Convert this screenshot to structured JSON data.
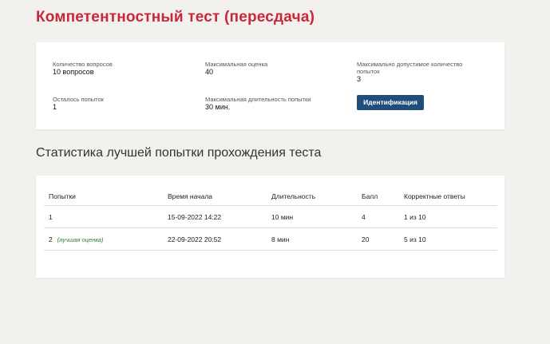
{
  "header": {
    "title": "Компетентностный тест (пересдача)"
  },
  "info": {
    "question_count_label": "Количество вопросов",
    "question_count_value": "10 вопросов",
    "max_score_label": "Максимальная оценка",
    "max_score_value": "40",
    "max_attempts_label": "Максимально допустимое количество попыток",
    "max_attempts_value": "3",
    "attempts_left_label": "Осталось попыток",
    "attempts_left_value": "1",
    "max_duration_label": "Максимальная длительность попытки",
    "max_duration_value": "30 мин.",
    "identify_button": "Идентификация"
  },
  "stats": {
    "title": "Статистика лучшей попытки прохождения теста",
    "columns": [
      "Попытки",
      "Время начала",
      "Длительность",
      "Балл",
      "Корректные ответы"
    ],
    "rows": [
      {
        "attempt": "1",
        "note": "",
        "start": "15-09-2022 14:22",
        "duration": "10 мин",
        "score": "4",
        "correct": "1 из 10"
      },
      {
        "attempt": "2",
        "note": "(лучшая оценка)",
        "start": "22-09-2022 20:52",
        "duration": "8 мин",
        "score": "20",
        "correct": "5 из 10"
      }
    ]
  },
  "colors": {
    "title_red": "#c8283a",
    "button_blue": "#1f4e7a",
    "best_note_green": "#2e7d32",
    "background": "#f2f1ee"
  }
}
